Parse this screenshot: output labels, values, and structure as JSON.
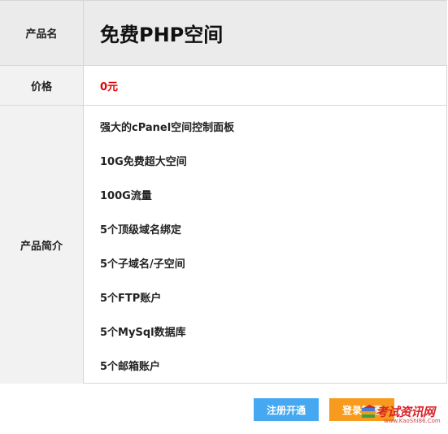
{
  "product": {
    "name_label": "产品名",
    "name": "免费PHP空间",
    "price_label": "价格",
    "price": "0元",
    "desc_label": "产品简介",
    "features": [
      "强大的cPanel空间控制面板",
      "10G免费超大空间",
      "100G流量",
      "5个顶级域名绑定",
      "5个子域名/子空间",
      "5个FTP账户",
      "5个MySql数据库",
      "5个邮箱账户"
    ]
  },
  "actions": {
    "register_label": "注册开通",
    "login_label": "登录管理"
  },
  "watermark": {
    "title": "考试资讯网",
    "url": "www.KaoShi86.Com"
  },
  "colors": {
    "price": "#e00000",
    "register_button": "#45a8f0",
    "login_button": "#f79a1d",
    "label_bg": "#f2f2f2"
  }
}
